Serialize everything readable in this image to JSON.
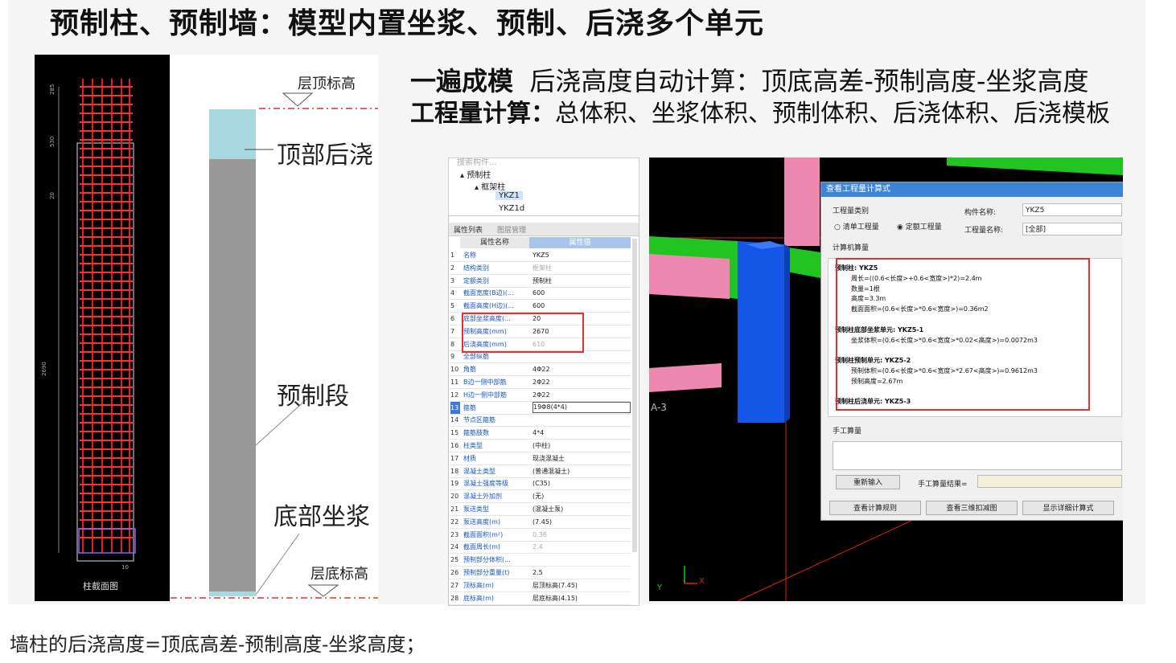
{
  "slide": {
    "title": "预制柱、预制墙：模型内置坐浆、预制、后浇多个单元",
    "heading1_bold": "一遍成模",
    "heading1_rest": "后浇高度自动计算：顶底高差-预制高度-坐浆高度",
    "heading2_bold": "工程量计算：",
    "heading2_rest": "总体积、坐浆体积、预制体积、后浇体积、后浇模板"
  },
  "drawing": {
    "dims": [
      "285",
      "530",
      "20",
      "2690",
      "10"
    ],
    "footer_label": "柱截面图"
  },
  "diagram": {
    "top_level_label": "层顶标高",
    "top_pour_label": "顶部后浇",
    "precast_label": "预制段",
    "grout_label": "底部坐浆",
    "bottom_level_label": "层底标高"
  },
  "tree": {
    "search_placeholder": "搜索构件...",
    "items": [
      "预制柱",
      "框架柱",
      "YKZ1",
      "YKZ1d"
    ]
  },
  "props": {
    "tabs": [
      "属性列表",
      "图层管理"
    ],
    "col_name": "属性名称",
    "col_value": "属性值",
    "rows": [
      {
        "n": "1",
        "k": "名称",
        "v": "YKZ5"
      },
      {
        "n": "2",
        "k": "结构类别",
        "v": "框架柱"
      },
      {
        "n": "3",
        "k": "定额类别",
        "v": "预制柱"
      },
      {
        "n": "4",
        "k": "截面宽度(B边)(...",
        "v": "600"
      },
      {
        "n": "5",
        "k": "截面高度(H边)(...",
        "v": "600"
      },
      {
        "n": "6",
        "k": "底部坐浆高度(...",
        "v": "20"
      },
      {
        "n": "7",
        "k": "预制高度(mm)",
        "v": "2670"
      },
      {
        "n": "8",
        "k": "后浇高度(mm)",
        "v": "610"
      },
      {
        "n": "9",
        "k": "全部纵筋",
        "v": ""
      },
      {
        "n": "10",
        "k": "角筋",
        "v": "4Φ22"
      },
      {
        "n": "11",
        "k": "B边一侧中部筋",
        "v": "2Φ22"
      },
      {
        "n": "12",
        "k": "H边一侧中部筋",
        "v": "2Φ22"
      },
      {
        "n": "13",
        "k": "箍筋",
        "v": "19Φ8(4*4)"
      },
      {
        "n": "14",
        "k": "节点区箍筋",
        "v": ""
      },
      {
        "n": "15",
        "k": "箍筋肢数",
        "v": "4*4"
      },
      {
        "n": "16",
        "k": "柱类型",
        "v": "(中柱)"
      },
      {
        "n": "17",
        "k": "材质",
        "v": "现浇混凝土"
      },
      {
        "n": "18",
        "k": "混凝土类型",
        "v": "(普通混凝土)"
      },
      {
        "n": "19",
        "k": "混凝土强度等级",
        "v": "(C35)"
      },
      {
        "n": "20",
        "k": "混凝土外加剂",
        "v": "(无)"
      },
      {
        "n": "21",
        "k": "泵送类型",
        "v": "(混凝土泵)"
      },
      {
        "n": "22",
        "k": "泵送高度(m)",
        "v": "(7.45)"
      },
      {
        "n": "23",
        "k": "截面面积(m²)",
        "v": "0.36"
      },
      {
        "n": "24",
        "k": "截面周长(m)",
        "v": "2.4"
      },
      {
        "n": "25",
        "k": "预制部分体积(...",
        "v": ""
      },
      {
        "n": "26",
        "k": "预制部分重量(t)",
        "v": "2.5"
      },
      {
        "n": "27",
        "k": "顶标高(m)",
        "v": "层顶标高(7.45)"
      },
      {
        "n": "28",
        "k": "底标高(m)",
        "v": "层底标高(4.15)"
      }
    ]
  },
  "viewport": {
    "axis_label": "A-3",
    "axis_y": "Y",
    "axis_x": "X"
  },
  "dialog": {
    "title": "查看工程量计算式",
    "qty_type_label": "工程量类别",
    "radio1": "清单工程量",
    "radio2": "定额工程量",
    "comp_name_label": "构件名称:",
    "comp_name_value": "YKZ5",
    "qty_name_label": "工程量名称:",
    "qty_name_value": "[全部]",
    "calc_label": "计算机算量",
    "calc_lines": [
      {
        "t": "预制柱: YKZ5",
        "b": true,
        "indent": 0
      },
      {
        "t": "周长=((0.6<长度>+0.6<宽度>)*2)=2.4m",
        "b": false,
        "indent": 1
      },
      {
        "t": "数量=1根",
        "b": false,
        "indent": 1
      },
      {
        "t": "高度=3.3m",
        "b": false,
        "indent": 1
      },
      {
        "t": "截面面积=(0.6<长度>*0.6<宽度>)=0.36m2",
        "b": false,
        "indent": 1
      },
      {
        "t": "",
        "b": false,
        "indent": 0
      },
      {
        "t": "预制柱底部坐浆单元: YKZ5-1",
        "b": true,
        "indent": 0
      },
      {
        "t": "坐浆体积=(0.6<长度>*0.6<宽度>*0.02<高度>)=0.0072m3",
        "b": false,
        "indent": 1
      },
      {
        "t": "",
        "b": false,
        "indent": 0
      },
      {
        "t": "预制柱预制单元: YKZ5-2",
        "b": true,
        "indent": 0
      },
      {
        "t": "预制体积=(0.6<长度>*0.6<宽度>*2.67<高度>)=0.9612m3",
        "b": false,
        "indent": 1
      },
      {
        "t": "预制高度=2.67m",
        "b": false,
        "indent": 1
      },
      {
        "t": "",
        "b": false,
        "indent": 0
      },
      {
        "t": "预制柱后浇单元: YKZ5-3",
        "b": true,
        "indent": 0
      }
    ],
    "manual_label": "手工算量",
    "reinput_button": "重新输入",
    "manual_result_label": "手工算量结果=",
    "btn_rules": "查看计算规则",
    "btn_3d": "查看三维扣减图",
    "btn_detail": "显示详细计算式"
  },
  "caption": "墙柱的后浇高度=顶底高差-预制高度-坐浆高度；"
}
